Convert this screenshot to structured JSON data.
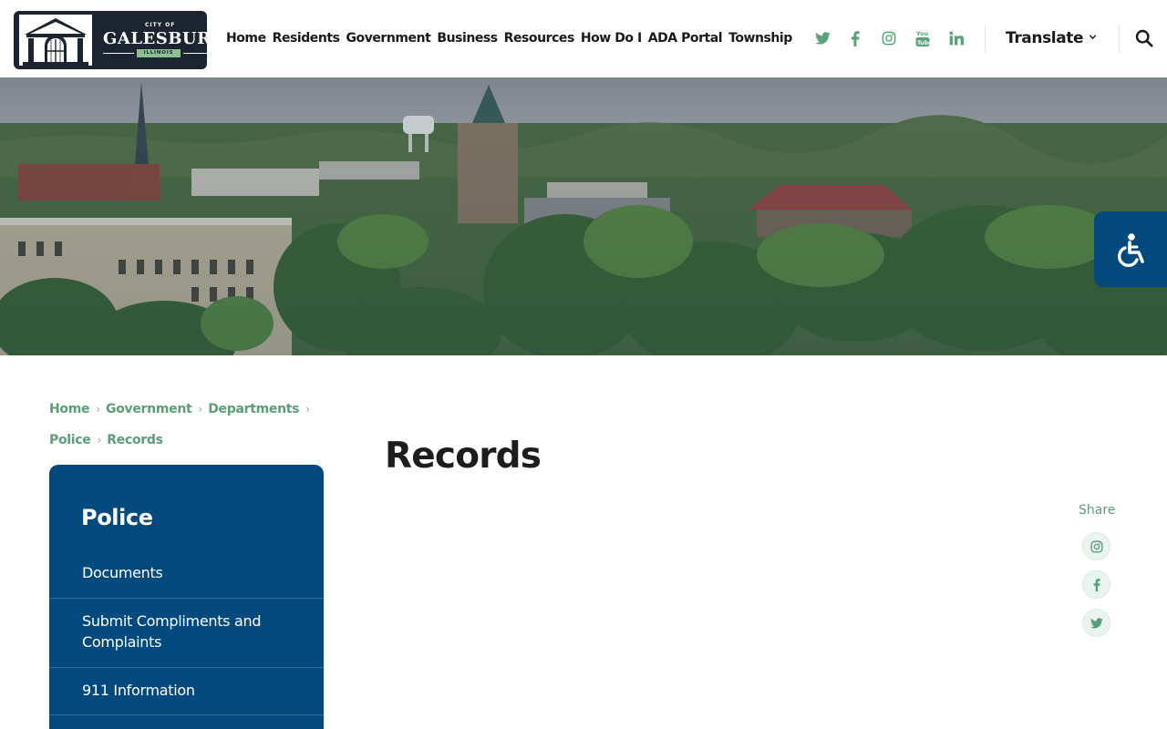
{
  "logo": {
    "city_of": "CITY OF",
    "name": "GALESBURG",
    "state": "ILLINOIS"
  },
  "nav": [
    "Home",
    "Residents",
    "Government",
    "Business",
    "Resources",
    "How Do I",
    "ADA Portal",
    "Township"
  ],
  "social_header": [
    "twitter-icon",
    "facebook-icon",
    "instagram-icon",
    "youtube-icon",
    "linkedin-icon"
  ],
  "translate": "Translate",
  "breadcrumb": [
    {
      "label": "Home"
    },
    {
      "label": "Government"
    },
    {
      "label": "Departments"
    },
    {
      "label": "Police"
    },
    {
      "label": "Records"
    }
  ],
  "sidebar": {
    "title": "Police",
    "items": [
      "Documents",
      "Submit Compliments and Complaints",
      "911 Information"
    ]
  },
  "page": {
    "title": "Records"
  },
  "share": {
    "label": "Share",
    "buttons": [
      "instagram-icon",
      "facebook-icon",
      "twitter-icon"
    ]
  },
  "colors": {
    "brand_navy": "#024a7e",
    "accent_green": "#5a9e78",
    "logo_bg": "#1d2431"
  }
}
